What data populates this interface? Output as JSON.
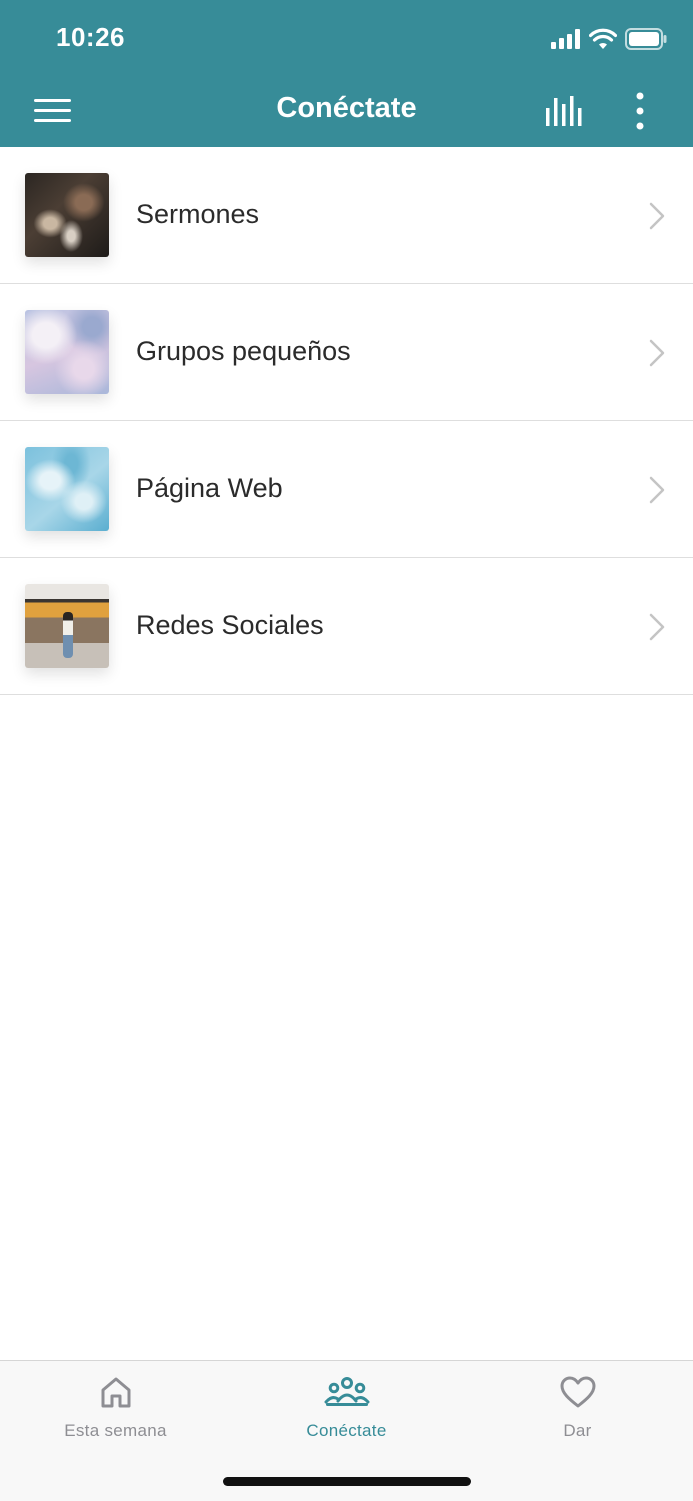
{
  "status_bar": {
    "time": "10:26"
  },
  "header": {
    "title": "Conéctate",
    "background": "#378c98",
    "menu_icon": "hamburger-icon",
    "stats_icon": "bar-chart-icon",
    "more_icon": "vertical-ellipsis-icon"
  },
  "list": {
    "items": [
      {
        "label": "Sermones",
        "thumbnail": "crowd-photo"
      },
      {
        "label": "Grupos pequeños",
        "thumbnail": "cloudy-sky-photo"
      },
      {
        "label": "Página Web",
        "thumbnail": "blue-sky-photo"
      },
      {
        "label": "Redes Sociales",
        "thumbnail": "train-platform-photo"
      }
    ]
  },
  "tabbar": {
    "accent": "#378c98",
    "tabs": [
      {
        "label": "Esta semana",
        "icon": "home-icon",
        "active": false
      },
      {
        "label": "Conéctate",
        "icon": "people-icon",
        "active": true
      },
      {
        "label": "Dar",
        "icon": "heart-icon",
        "active": false
      }
    ]
  }
}
